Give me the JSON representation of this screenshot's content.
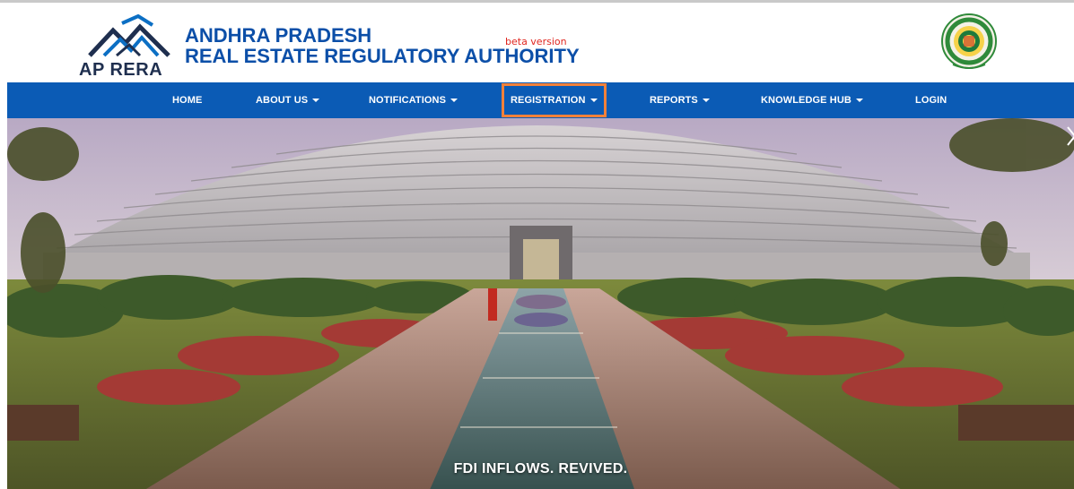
{
  "header": {
    "logo_text": "AP RERA",
    "org_line1": "ANDHRA PRADESH",
    "org_line2": "REAL ESTATE REGULATORY AUTHORITY",
    "beta_label": "beta version"
  },
  "nav": {
    "items": [
      {
        "label": "HOME",
        "dropdown": false
      },
      {
        "label": "ABOUT US",
        "dropdown": true
      },
      {
        "label": "NOTIFICATIONS",
        "dropdown": true
      },
      {
        "label": "REGISTRATION",
        "dropdown": true,
        "highlighted": true
      },
      {
        "label": "REPORTS",
        "dropdown": true
      },
      {
        "label": "KNOWLEDGE HUB",
        "dropdown": true
      },
      {
        "label": "LOGIN",
        "dropdown": false
      }
    ]
  },
  "hero": {
    "caption": "FDI INFLOWS. REVIVED."
  },
  "colors": {
    "nav_bg": "#0b5bb5",
    "brand_blue": "#0c4fa8",
    "highlight": "#f2813a",
    "beta_red": "#e0261f"
  }
}
